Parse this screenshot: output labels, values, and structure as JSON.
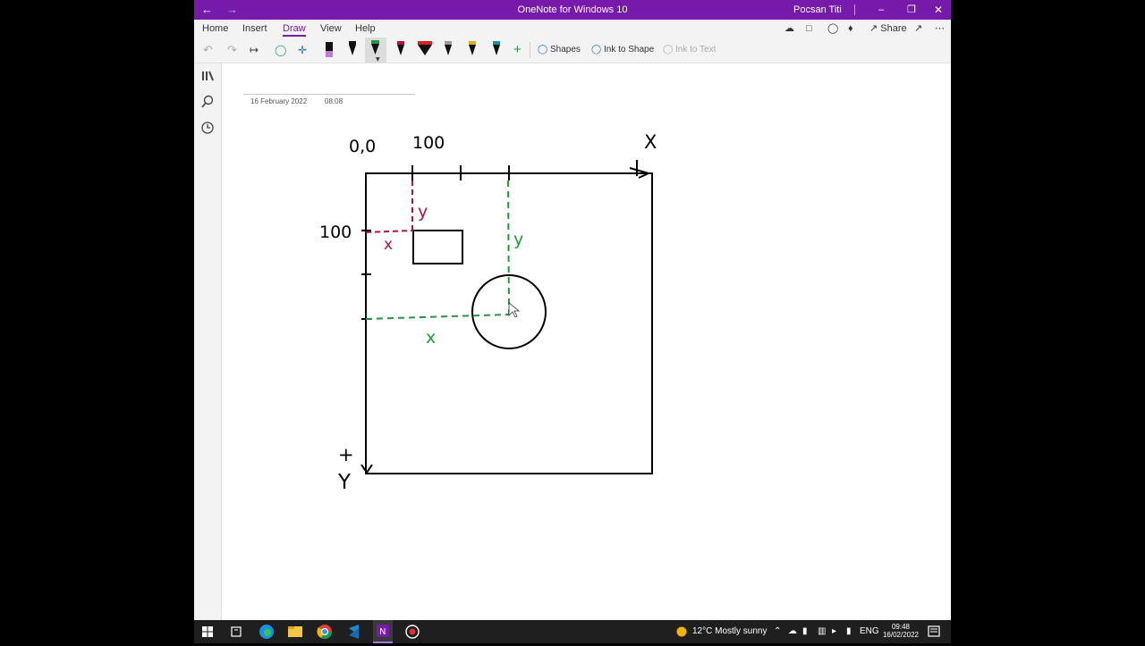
{
  "titlebar": {
    "app_title": "OneNote for Windows 10",
    "user_name": "Pocsan Titi"
  },
  "ribbon": {
    "tabs": [
      "Home",
      "Insert",
      "Draw",
      "View",
      "Help"
    ],
    "active_tab": "Draw",
    "share_label": "Share"
  },
  "toolbar": {
    "shapes_label": "Shapes",
    "ink_to_shape_label": "Ink to Shape",
    "ink_to_text_label": "Ink to Text"
  },
  "page": {
    "date": "16 February 2022",
    "time": "08:08"
  },
  "drawing": {
    "origin_label": "0,0",
    "x_tick_label": "100",
    "y_tick_label": "100",
    "x_axis_label": "X",
    "y_axis_label": "Y",
    "y_axis_plus": "+",
    "rect_x_label": "x",
    "rect_y_label": "y",
    "circle_x_label": "x",
    "circle_y_label": "y"
  },
  "colors": {
    "brand": "#7719aa",
    "ink_black": "#000000",
    "ink_red": "#b5123e",
    "ink_green": "#1e9a3f"
  },
  "taskbar": {
    "weather": "12°C  Mostly sunny",
    "language": "ENG",
    "time": "09:48",
    "date": "16/02/2022"
  }
}
